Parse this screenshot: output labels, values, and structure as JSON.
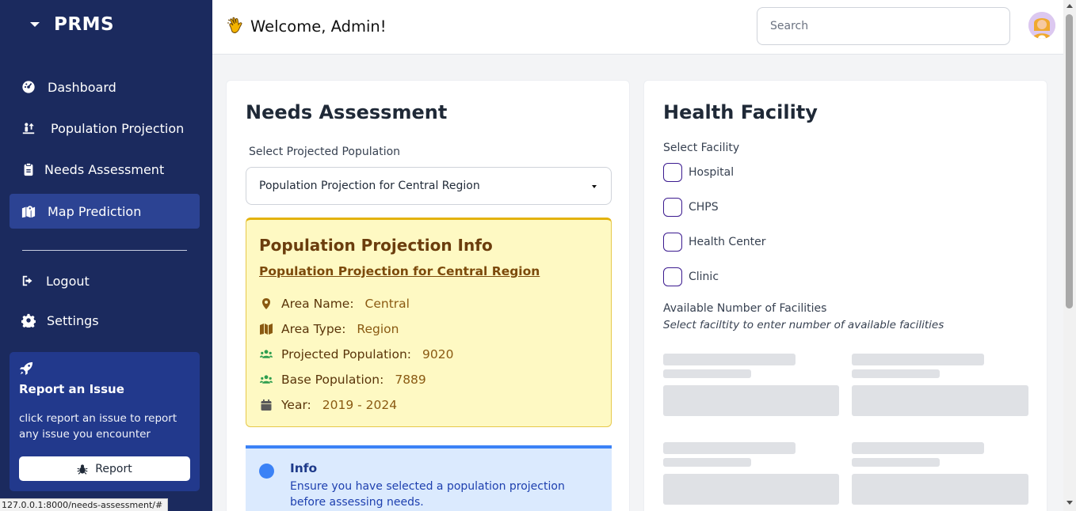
{
  "sidebar": {
    "brand": "PRMS",
    "items": [
      {
        "label": "Dashboard",
        "icon": "gauge-icon"
      },
      {
        "label": "Population Projection",
        "icon": "people-up-icon"
      },
      {
        "label": "Needs Assessment",
        "icon": "clipboard-icon"
      },
      {
        "label": "Map Prediction",
        "icon": "map-location-icon",
        "active": true
      },
      {
        "label": "Logout",
        "icon": "sign-out-icon"
      },
      {
        "label": "Settings",
        "icon": "gear-icon"
      }
    ],
    "report": {
      "title": "Report an Issue",
      "description": "click report an issue to report any issue you encounter",
      "button_label": "Report"
    }
  },
  "status_url": "127.0.0.1:8000/needs-assessment/#",
  "header": {
    "welcome": "Welcome, Admin!",
    "search_placeholder": "Search"
  },
  "needs": {
    "title": "Needs Assessment",
    "select_label": "Select Projected Population",
    "selected_value": "Population Projection for Central Region",
    "info_card": {
      "title": "Population Projection Info",
      "link": "Population Projection for Central Region",
      "area_name_label": "Area Name:",
      "area_name": "Central",
      "area_type_label": "Area Type:",
      "area_type": "Region",
      "projected_label": "Projected Population:",
      "projected": "9020",
      "base_label": "Base Population:",
      "base": "7889",
      "year_label": "Year:",
      "year": "2019 - 2024"
    },
    "info_alert": {
      "title": "Info",
      "text": "Ensure you have selected a population projection before assessing needs."
    }
  },
  "facility": {
    "title": "Health Facility",
    "select_label": "Select Facility",
    "options": [
      "Hospital",
      "CHPS",
      "Health Center",
      "Clinic"
    ],
    "available_label": "Available Number of Facilities",
    "available_hint": "Select faciltity to enter number of available facilities"
  },
  "colors": {
    "sidebar": "#1b2a5e",
    "active_nav": "#2c4393",
    "info_card_bg": "#fef9c3",
    "info_alert_bg": "#dbeafe",
    "checkbox_border": "#3b1a8f"
  }
}
